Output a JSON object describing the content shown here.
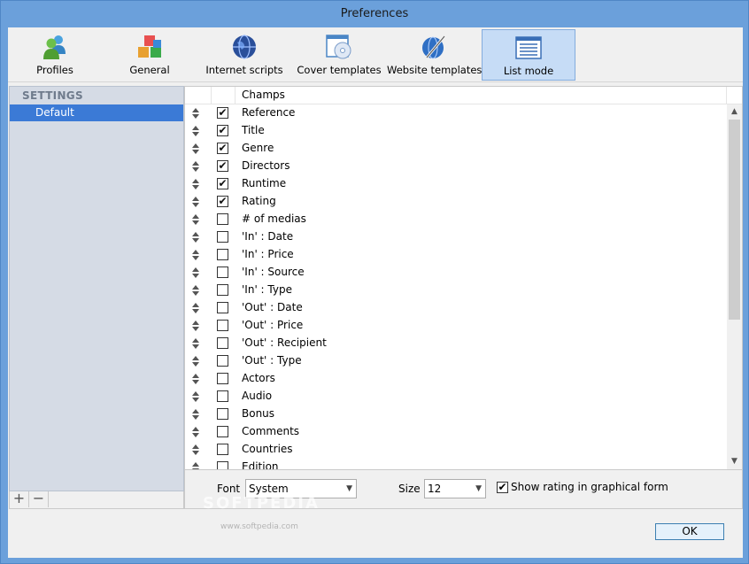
{
  "window": {
    "title": "Preferences"
  },
  "toolbar": {
    "buttons": [
      {
        "label": "Profiles",
        "icon": "users-icon"
      },
      {
        "label": "General",
        "icon": "cubes-icon"
      },
      {
        "label": "Internet scripts",
        "icon": "globe-icon"
      },
      {
        "label": "Cover templates",
        "icon": "cd-window-icon"
      },
      {
        "label": "Website templates",
        "icon": "web-pen-icon"
      },
      {
        "label": "List mode",
        "icon": "list-window-icon",
        "active": true
      }
    ]
  },
  "sidebar": {
    "header": "SETTINGS",
    "items": [
      {
        "label": "Default",
        "selected": true
      }
    ],
    "add_label": "+",
    "remove_label": "−"
  },
  "fields": {
    "column_header": "Champs",
    "rows": [
      {
        "label": "Reference",
        "checked": true
      },
      {
        "label": "Title",
        "checked": true
      },
      {
        "label": "Genre",
        "checked": true
      },
      {
        "label": "Directors",
        "checked": true
      },
      {
        "label": "Runtime",
        "checked": true
      },
      {
        "label": "Rating",
        "checked": true
      },
      {
        "label": "# of medias",
        "checked": false
      },
      {
        "label": "'In' : Date",
        "checked": false
      },
      {
        "label": "'In' : Price",
        "checked": false
      },
      {
        "label": "'In' : Source",
        "checked": false
      },
      {
        "label": "'In' : Type",
        "checked": false
      },
      {
        "label": "'Out' : Date",
        "checked": false
      },
      {
        "label": "'Out' : Price",
        "checked": false
      },
      {
        "label": "'Out' : Recipient",
        "checked": false
      },
      {
        "label": "'Out' : Type",
        "checked": false
      },
      {
        "label": "Actors",
        "checked": false
      },
      {
        "label": "Audio",
        "checked": false
      },
      {
        "label": "Bonus",
        "checked": false
      },
      {
        "label": "Comments",
        "checked": false
      },
      {
        "label": "Countries",
        "checked": false
      },
      {
        "label": "Edition",
        "checked": false
      }
    ]
  },
  "font_settings": {
    "font_label": "Font",
    "font_value": "System",
    "size_label": "Size",
    "size_value": "12",
    "show_rating_label": "Show rating in graphical form",
    "show_rating_checked": true
  },
  "footer": {
    "ok_label": "OK"
  },
  "watermark": {
    "text": "SOFTPEDIA",
    "sub": "www.softpedia.com"
  },
  "colors": {
    "accent": "#3b7ad6",
    "active_tab": "#c6dcf6",
    "frame": "#6ba0db"
  }
}
